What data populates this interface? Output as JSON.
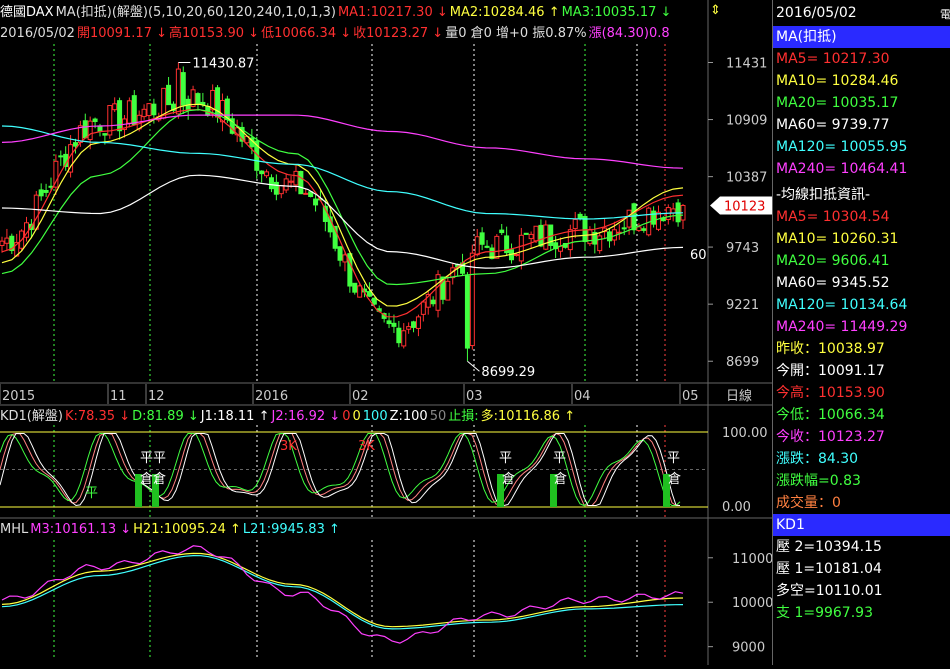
{
  "main_header": {
    "line1": [
      {
        "text": "德國DAX",
        "color": "#ffffff"
      },
      {
        "text": "MA(扣抵)(解盤)(5,10,20,60,120,240,1,0,1,3)",
        "color": "#dddddd"
      },
      {
        "text": "MA1:10217.30 ↓",
        "color": "#ff3030"
      },
      {
        "text": "MA2:10284.46 ↑",
        "color": "#ffff40"
      },
      {
        "text": "MA3:10035.17 ↓",
        "color": "#40ff40"
      }
    ],
    "line2": [
      {
        "text": "2016/05/02",
        "color": "#dddddd"
      },
      {
        "text": "開10091.17 ↓",
        "color": "#ff3030"
      },
      {
        "text": "高10153.90 ↓",
        "color": "#ff3030"
      },
      {
        "text": "低10066.34 ↓",
        "color": "#ff3030"
      },
      {
        "text": "收10123.27 ↓",
        "color": "#ff3030"
      },
      {
        "text": "量0 倉0 增+0 振0.87%",
        "color": "#dddddd"
      },
      {
        "text": "漲(84.30)0.8",
        "color": "#ff40ff"
      }
    ],
    "scroll_glyph": "⇕"
  },
  "price_axis": {
    "labels": [
      "11431",
      "10909",
      "10387",
      "9743",
      "9221",
      "8699"
    ],
    "current_tag": "10123"
  },
  "annotations": {
    "high_label": "11430.87",
    "low_label": "8699.29",
    "ma60_label": "60"
  },
  "date_axis": {
    "labels": [
      "2015",
      "11",
      "12",
      "2016",
      "02",
      "03",
      "04",
      "05"
    ],
    "unit": "日線"
  },
  "kd_panel": {
    "header": [
      {
        "text": "KD1(解盤)",
        "color": "#dddddd"
      },
      {
        "text": "K:78.35 ↓",
        "color": "#ff3030"
      },
      {
        "text": "D:81.89 ↓",
        "color": "#40ff40"
      },
      {
        "text": "J1:18.11 ↑",
        "color": "#ffffff"
      },
      {
        "text": "J2:16.92 ↓",
        "color": "#ff40ff"
      },
      {
        "text": "0",
        "color": "#ff3030"
      },
      {
        "text": "0",
        "color": "#ffff40"
      },
      {
        "text": "100",
        "color": "#40ffff"
      },
      {
        "text": "Z:100",
        "color": "#ffffff"
      },
      {
        "text": "50",
        "color": "#888888"
      },
      {
        "text": "止損:",
        "color": "#40ff40"
      },
      {
        "text": "多:10116.86 ↑",
        "color": "#ffff40"
      }
    ],
    "axis_labels": [
      "100.00",
      "0.00"
    ],
    "marks": [
      {
        "text": "平",
        "color": "#40ff40"
      },
      {
        "text": "平",
        "color": "#ffffff"
      },
      {
        "text": "平",
        "color": "#ffffff"
      },
      {
        "text": "倉",
        "color": "#ffffff"
      },
      {
        "text": "倉",
        "color": "#ffffff"
      },
      {
        "text": "3K",
        "color": "#ff3030"
      },
      {
        "text": "3K",
        "color": "#ff3030"
      },
      {
        "text": "平",
        "color": "#ffffff"
      },
      {
        "text": "倉",
        "color": "#ffffff"
      },
      {
        "text": "平",
        "color": "#ffffff"
      },
      {
        "text": "倉",
        "color": "#ffffff"
      },
      {
        "text": "平",
        "color": "#ffffff"
      },
      {
        "text": "倉",
        "color": "#ffffff"
      }
    ]
  },
  "mhl_panel": {
    "header": [
      {
        "text": "MHL",
        "color": "#dddddd"
      },
      {
        "text": "M3:10161.13 ↓",
        "color": "#ff40ff"
      },
      {
        "text": "H21:10095.24 ↑",
        "color": "#ffff40"
      },
      {
        "text": "L21:9945.83 ↑",
        "color": "#40ffff"
      }
    ],
    "axis_labels": [
      "11000",
      "10000",
      "9000"
    ]
  },
  "right_panel": {
    "date": "2016/05/02",
    "corner": "電",
    "ma_header": "MA(扣抵)",
    "ma_rows": [
      {
        "text": "MA5= 10217.30",
        "color": "#ff3030"
      },
      {
        "text": "MA10= 10284.46",
        "color": "#ffff40"
      },
      {
        "text": "MA20= 10035.17",
        "color": "#40ff40"
      },
      {
        "text": "MA60= 9739.77",
        "color": "#ffffff"
      },
      {
        "text": "MA120= 10055.95",
        "color": "#40ffff"
      },
      {
        "text": "MA240= 10464.41",
        "color": "#ff40ff"
      }
    ],
    "deduct_title": "-均線扣抵資訊-",
    "deduct_rows": [
      {
        "text": "MA5= 10304.54",
        "color": "#ff3030"
      },
      {
        "text": "MA10= 10260.31",
        "color": "#ffff40"
      },
      {
        "text": "MA20= 9606.41",
        "color": "#40ff40"
      },
      {
        "text": "MA60= 9345.52",
        "color": "#ffffff"
      },
      {
        "text": "MA120= 10134.64",
        "color": "#40ffff"
      },
      {
        "text": "MA240= 11449.29",
        "color": "#ff40ff"
      }
    ],
    "quote_rows": [
      {
        "text": "昨收：10038.97",
        "color": "#ffff40"
      },
      {
        "text": "今開：10091.17",
        "color": "#ffffff"
      },
      {
        "text": "今高：10153.90",
        "color": "#ff3030"
      },
      {
        "text": "今低：10066.34",
        "color": "#40ff40"
      },
      {
        "text": "今收：10123.27",
        "color": "#ff40ff"
      },
      {
        "text": "漲跌：84.30",
        "color": "#40ffff"
      },
      {
        "text": "漲跌幅=0.83",
        "color": "#40ff40"
      },
      {
        "text": "成交量：0",
        "color": "#ff8040"
      }
    ],
    "kd_header": "KD1",
    "kd_rows": [
      {
        "text": "壓 2=10394.15",
        "color": "#ffffff"
      },
      {
        "text": "壓 1=10181.04",
        "color": "#ffffff"
      },
      {
        "text": "多空=10110.01",
        "color": "#ffffff"
      },
      {
        "text": "支 1=9967.93",
        "color": "#40ff40"
      }
    ]
  },
  "chart_data": {
    "type": "candlestick",
    "x": [
      "2015-10",
      "2015-11",
      "2015-12",
      "2016-01",
      "2016-02",
      "2016-03",
      "2016-04",
      "2016-05-02"
    ],
    "close": [
      9800,
      10900,
      11100,
      10300,
      9000,
      9750,
      9900,
      10123.27
    ],
    "high": 11430.87,
    "low": 8699.29,
    "ylim": [
      8500,
      11600
    ],
    "series": [
      {
        "name": "MA5",
        "values": [
          9700,
          10800,
          11000,
          10400,
          9100,
          9700,
          9900,
          10217.3
        ]
      },
      {
        "name": "MA10",
        "values": [
          9600,
          10700,
          11050,
          10500,
          9200,
          9650,
          9850,
          10284.46
        ]
      },
      {
        "name": "MA20",
        "values": [
          9500,
          10400,
          11000,
          10600,
          9400,
          9500,
          9800,
          10035.17
        ]
      },
      {
        "name": "MA60",
        "values": [
          10100,
          10050,
          10400,
          10300,
          9700,
          9550,
          9650,
          9739.77
        ]
      },
      {
        "name": "MA120",
        "values": [
          10850,
          10700,
          10600,
          10500,
          10250,
          10050,
          10000,
          10055.95
        ]
      },
      {
        "name": "MA240",
        "values": [
          10700,
          10850,
          10950,
          10950,
          10800,
          10650,
          10550,
          10464.41
        ]
      }
    ]
  }
}
